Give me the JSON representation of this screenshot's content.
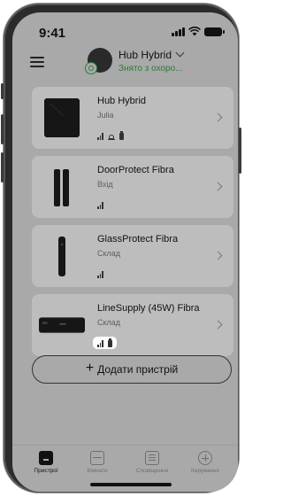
{
  "status_bar": {
    "time": "9:41"
  },
  "header": {
    "hub_name": "Hub Hybrid",
    "hub_status": "Знято з охоро..."
  },
  "devices": [
    {
      "name": "Hub Hybrid",
      "room": "Julia",
      "icons": [
        "signal-icon",
        "siren-icon",
        "battery-icon"
      ]
    },
    {
      "name": "DoorProtect Fibra",
      "room": "Вхід",
      "icons": [
        "signal-icon"
      ]
    },
    {
      "name": "GlassProtect Fibra",
      "room": "Склад",
      "icons": [
        "signal-icon"
      ]
    },
    {
      "name": "LineSupply (45W) Fibra",
      "room": "Склад",
      "icons": [
        "signal-icon",
        "battery-icon"
      ]
    }
  ],
  "add_button": {
    "plus": "+",
    "label": "Додати пристрій"
  },
  "tabs": [
    {
      "label": "Пристрої",
      "icon": "devices-icon",
      "active": true
    },
    {
      "label": "Кімнати",
      "icon": "rooms-icon",
      "active": false
    },
    {
      "label": "Сповіщення",
      "icon": "notifications-icon",
      "active": false
    },
    {
      "label": "Керування",
      "icon": "control-icon",
      "active": false
    }
  ],
  "colors": {
    "accent_green": "#2a7a36",
    "overlay_gray": "#a9a9a9",
    "card_gray": "#bdbdbd"
  }
}
